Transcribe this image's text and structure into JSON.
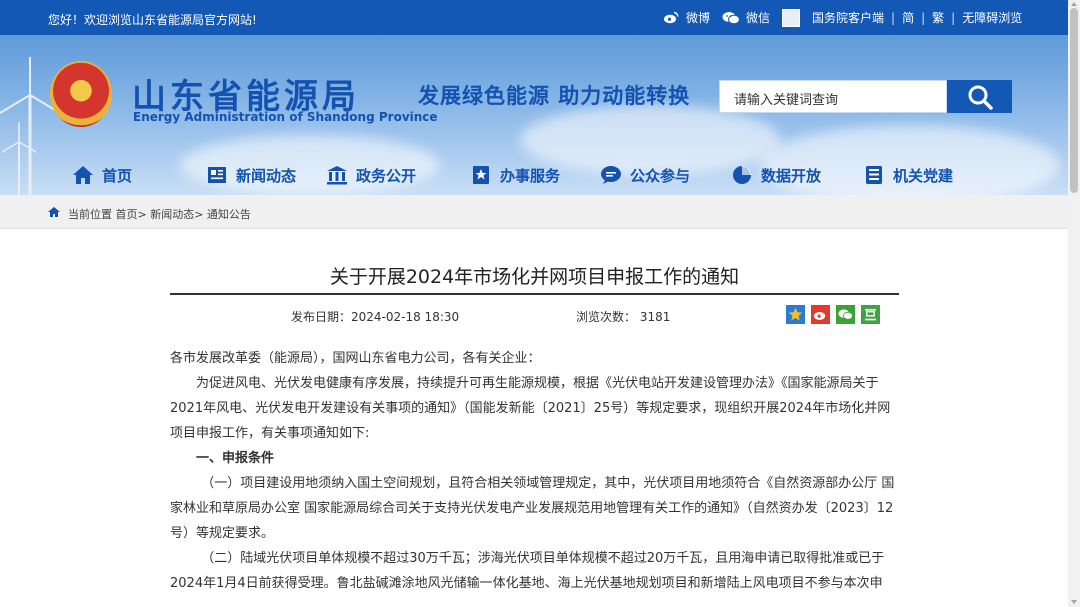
{
  "topbar": {
    "welcome": "您好！欢迎浏览山东省能源局官方网站!",
    "weibo": "微博",
    "weixin": "微信",
    "gwy": "国务院客户端",
    "jian": "简",
    "fan": "繁",
    "accessible": "无障碍浏览"
  },
  "header": {
    "title": "山东省能源局",
    "subtitle": "Energy Administration of Shandong Province",
    "slogan": "发展绿色能源  助力动能转换",
    "search_placeholder": "请输入关键词查询"
  },
  "nav": {
    "items": [
      {
        "label": "首页"
      },
      {
        "label": "新闻动态"
      },
      {
        "label": "政务公开"
      },
      {
        "label": "办事服务"
      },
      {
        "label": "公众参与"
      },
      {
        "label": "数据开放"
      },
      {
        "label": "机关党建"
      }
    ]
  },
  "breadcrumb": {
    "text": "当前位置 首页> 新闻动态> 通知公告"
  },
  "article": {
    "title": "关于开展2024年市场化并网项目申报工作的通知",
    "publish": "发布日期：2024-02-18 18:30",
    "views": "浏览次数：  3181",
    "paragraphs": [
      "各市发展改革委（能源局），国网山东省电力公司，各有关企业：",
      "为促进风电、光伏发电健康有序发展，持续提升可再生能源规模，根据《光伏电站开发建设管理办法》《国家能源局关于2021年风电、光伏发电开发建设有关事项的通知》（国能发新能〔2021〕25号）等规定要求，现组织开展2024年市场化并网项目申报工作，有关事项通知如下:",
      "一、申报条件",
      "（一）项目建设用地须纳入国土空间规划，且符合相关领域管理规定，其中，光伏项目用地须符合《自然资源部办公厅 国家林业和草原局办公室 国家能源局综合司关于支持光伏发电产业发展规范用地管理有关工作的通知》（自然资办发〔2023〕12号）等规定要求。",
      "（二）陆域光伏项目单体规模不超过30万千瓦；涉海光伏项目单体规模不超过20万千瓦，且用海申请已取得批准或已于2024年1月4日前获得受理。鲁北盐碱滩涂地风光储输一体化基地、海上光伏基地规划项目和新增陆上风电项目不参与本次申"
    ]
  },
  "colors": {
    "brand_blue": "#1458b5",
    "title_blue": "#1452b0"
  }
}
